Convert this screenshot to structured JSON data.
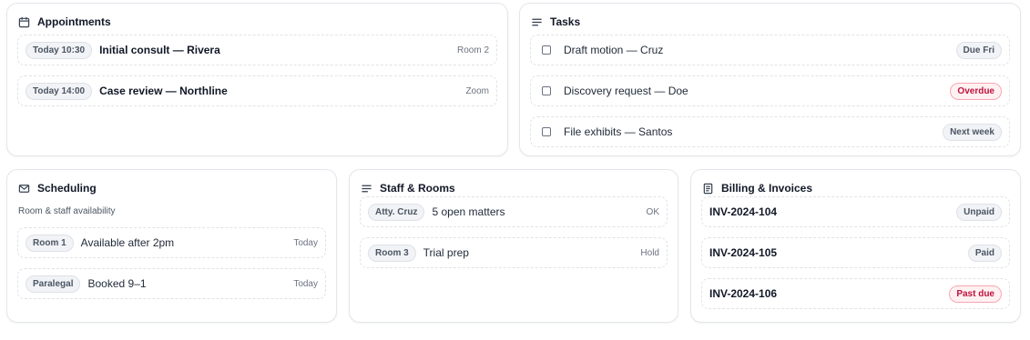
{
  "appointments": {
    "title": "Appointments",
    "items": [
      {
        "time": "Today 10:30",
        "title": "Initial consult — Rivera",
        "location": "Room 2"
      },
      {
        "time": "Today 14:00",
        "title": "Case review — Northline",
        "location": "Zoom"
      }
    ]
  },
  "tasks": {
    "title": "Tasks",
    "items": [
      {
        "label": "Draft motion — Cruz",
        "status": "Due Fri",
        "status_color": "#4b5563"
      },
      {
        "label": "Discovery request — Doe",
        "status": "Overdue",
        "status_color": "#be123c"
      },
      {
        "label": "File exhibits — Santos",
        "status": "Next week",
        "status_color": "#4b5563"
      }
    ]
  },
  "scheduling": {
    "title": "Scheduling",
    "subtitle": "Room & staff availability",
    "items": [
      {
        "resource": "Room 1",
        "detail": "Available after 2pm",
        "when": "Today"
      },
      {
        "resource": "Paralegal",
        "detail": "Booked 9–1",
        "when": "Today"
      }
    ]
  },
  "staff_rooms": {
    "title": "Staff & Rooms",
    "items": [
      {
        "name": "Atty. Cruz",
        "detail": "5 open matters",
        "status": "OK"
      },
      {
        "name": "Room 3",
        "detail": "Trial prep",
        "status": "Hold"
      }
    ]
  },
  "billing": {
    "title": "Billing & Invoices",
    "items": [
      {
        "invoice": "INV-2024-104",
        "status": "Unpaid"
      },
      {
        "invoice": "INV-2024-105",
        "status": "Paid"
      },
      {
        "invoice": "INV-2024-106",
        "status": "Past due"
      }
    ]
  },
  "colors": {
    "danger": "#be123c",
    "danger_bg": "#fff1f2",
    "neutral_chip": "#f1f3f6",
    "border": "#e3e6ea"
  },
  "icons": {
    "appointments": "calendar-icon",
    "tasks": "list-icon",
    "scheduling": "mail-icon",
    "staff_rooms": "list-icon",
    "billing": "receipt-icon"
  }
}
